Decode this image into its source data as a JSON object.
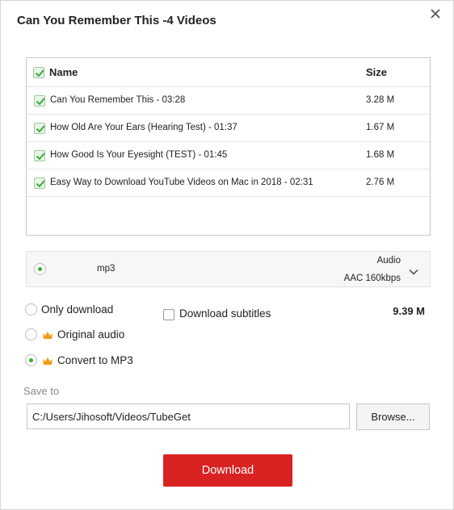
{
  "dialog": {
    "title": "Can You Remember This -4 Videos"
  },
  "list": {
    "headers": {
      "name": "Name",
      "size": "Size"
    },
    "rows": [
      {
        "title": "Can You Remember This - 03:28",
        "size": "3.28 M",
        "checked": true
      },
      {
        "title": "How Old Are Your Ears (Hearing Test) - 01:37",
        "size": "1.67 M",
        "checked": true
      },
      {
        "title": "How Good Is Your Eyesight (TEST) - 01:45",
        "size": "1.68 M",
        "checked": true
      },
      {
        "title": "Easy Way to Download YouTube Videos on Mac in 2018 - 02:31",
        "size": "2.76 M",
        "checked": true
      }
    ]
  },
  "format": {
    "name": "mp3",
    "type": "Audio",
    "quality": "AAC 160kbps"
  },
  "options": {
    "only_download": "Only download",
    "original_audio": "Original audio",
    "convert_mp3": "Convert to MP3",
    "selected": "convert_mp3",
    "download_subtitles": "Download subtitles",
    "subtitles_checked": false
  },
  "total_size": "9.39 M",
  "save": {
    "label": "Save to",
    "path": "C:/Users/Jihosoft/Videos/TubeGet",
    "browse_label": "Browse..."
  },
  "download_label": "Download",
  "colors": {
    "accent_green": "#3aaa3a",
    "download_red": "#d92222",
    "crown_orange": "#f39c12"
  }
}
